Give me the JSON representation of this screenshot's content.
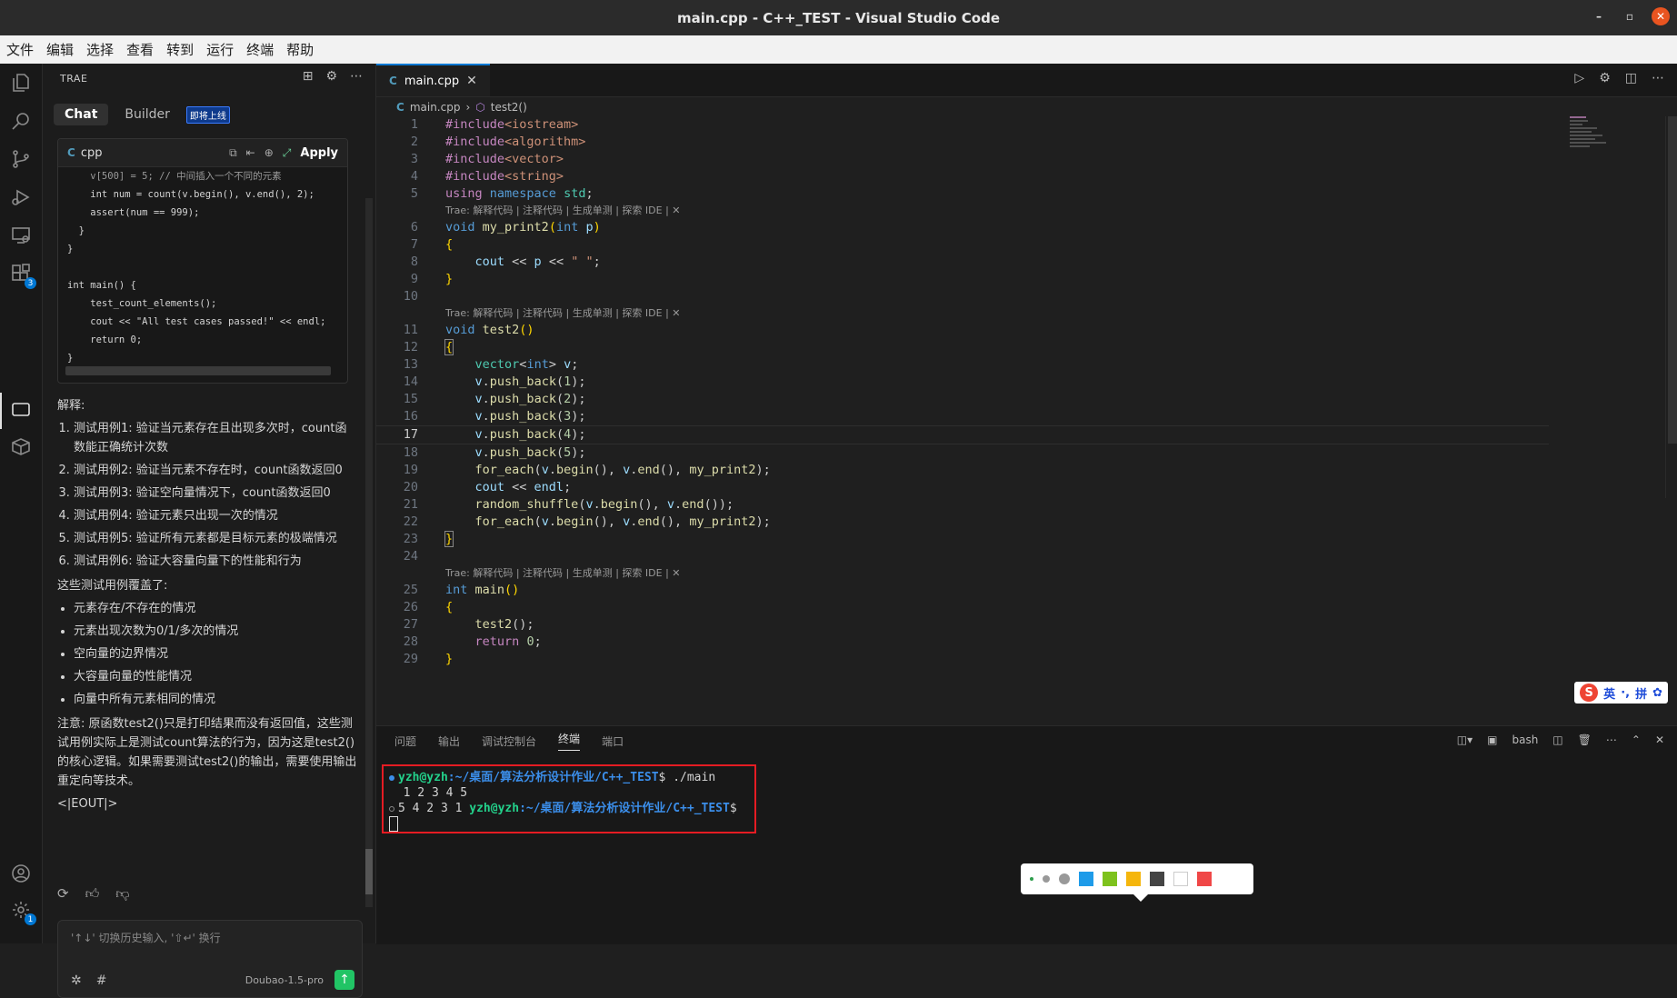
{
  "window": {
    "title": "main.cpp - C++_TEST - Visual Studio Code",
    "close_glyph": "✕",
    "min_glyph": "–",
    "max_glyph": "▫"
  },
  "menu": [
    "文件",
    "编辑",
    "选择",
    "查看",
    "转到",
    "运行",
    "终端",
    "帮助"
  ],
  "activity": {
    "extensions_badge": "3",
    "settings_badge": "1"
  },
  "sidebar": {
    "title": "TRAE",
    "tabs": {
      "chat": "Chat",
      "builder": "Builder",
      "soon": "即将上线"
    },
    "codecard": {
      "lang": "cpp",
      "apply": "Apply",
      "lines": [
        "    v[500] = 5; // 中间插入一个不同的元素",
        "    int num = count(v.begin(), v.end(), 2);",
        "    assert(num == 999);",
        "  }",
        "}",
        "",
        "int main() {",
        "    test_count_elements();",
        "    cout << \"All test cases passed!\" << endl;",
        "    return 0;",
        "}"
      ]
    },
    "explain_title": "解释:",
    "explain_items": [
      "测试用例1: 验证当元素存在且出现多次时，count函数能正确统计次数",
      "测试用例2: 验证当元素不存在时，count函数返回0",
      "测试用例3: 验证空向量情况下，count函数返回0",
      "测试用例4: 验证元素只出现一次的情况",
      "测试用例5: 验证所有元素都是目标元素的极端情况",
      "测试用例6: 验证大容量向量下的性能和行为"
    ],
    "cover_title": "这些测试用例覆盖了:",
    "cover_items": [
      "元素存在/不存在的情况",
      "元素出现次数为0/1/多次的情况",
      "空向量的边界情况",
      "大容量向量的性能情况",
      "向量中所有元素相同的情况"
    ],
    "note": "注意: 原函数test2()只是打印结果而没有返回值，这些测试用例实际上是测试count算法的行为，因为这是test2()的核心逻辑。如果需要测试test2()的输出，需要使用输出重定向等技术。",
    "eout": "<|EOUT|>",
    "input_placeholder": "'↑↓' 切换历史输入, '⇧↵' 换行",
    "model": "Doubao-1.5-pro"
  },
  "editor": {
    "tab": "main.cpp",
    "breadcrumb_file": "main.cpp",
    "breadcrumb_symbol": "test2()",
    "codelens": "Trae: 解释代码 | 注释代码 | 生成单测 | 探索 IDE | ✕",
    "current_line": 17
  },
  "ime": {
    "logo": "S",
    "mode1": "英",
    "mode2": "·,",
    "mode3": "拼",
    "gear": "✿"
  },
  "panel": {
    "tabs": [
      "问题",
      "输出",
      "调试控制台",
      "终端",
      "端口"
    ],
    "active_tab": "终端",
    "shell": "bash",
    "terminal": {
      "prompt_user": "yzh@yzh",
      "path": ":~/桌面/算法分析设计作业/C++_TEST",
      "cmd": "$ ./main",
      "out1": "1 2 3 4 5",
      "out2": "5 4 2 3 1 ",
      "prompt_end": "$"
    }
  },
  "palette_colors": [
    "#1e9be9",
    "#7dc21d",
    "#f5b60c",
    "#444444",
    "#ffffff",
    "#f04747"
  ]
}
